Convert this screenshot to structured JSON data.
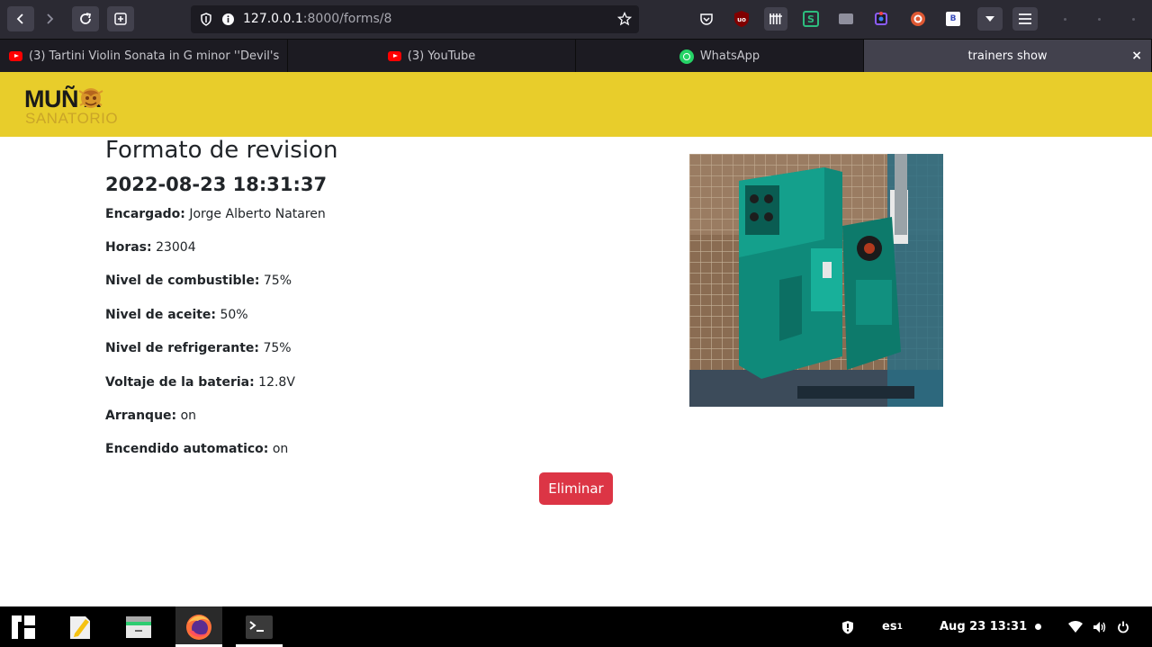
{
  "browser": {
    "url_host": "127.0.0.1",
    "url_path": ":8000/forms/8",
    "tabs": [
      {
        "label": "(3) Tartini Violin Sonata in G minor ''Devil's",
        "icon": "youtube-icon"
      },
      {
        "label": "(3) YouTube",
        "icon": "youtube-icon"
      },
      {
        "label": "WhatsApp",
        "icon": "whatsapp-icon"
      },
      {
        "label": "trainers show",
        "icon": ""
      }
    ],
    "close_tab_glyph": "×",
    "extensions": [
      {
        "name": "pocket-icon"
      },
      {
        "name": "ublock-icon",
        "text": "uo"
      },
      {
        "name": "columns-extension-icon"
      },
      {
        "name": "s-extension-icon",
        "text": "S"
      },
      {
        "name": "keyboard-extension-icon"
      },
      {
        "name": "puzzle-extension-icon"
      },
      {
        "name": "duckduckgo-icon"
      },
      {
        "name": "b-extension-icon",
        "text": "B"
      }
    ]
  },
  "site": {
    "logo_text": "MUÑ A",
    "logo_subtext": "SANATORIO",
    "brand_color": "#e8cd2b"
  },
  "form": {
    "title": "Formato de revision",
    "datetime": "2022-08-23 18:31:37",
    "fields": [
      {
        "label": "Encargado:",
        "value": "Jorge Alberto Nataren"
      },
      {
        "label": "Horas:",
        "value": "23004"
      },
      {
        "label": "Nivel de combustible:",
        "value": "75%"
      },
      {
        "label": "Nivel de aceite:",
        "value": "50%"
      },
      {
        "label": "Nivel de refrigerante:",
        "value": "75%"
      },
      {
        "label": "Voltaje de la bateria:",
        "value": "12.8V"
      },
      {
        "label": "Arranque:",
        "value": "on"
      },
      {
        "label": "Encendido automatico:",
        "value": "on"
      }
    ],
    "delete_label": "Eliminar",
    "delete_color": "#dc3545"
  },
  "taskbar": {
    "keyboard_layout": "es",
    "keyboard_layout_index": "1",
    "datetime": "Aug 23  13:31"
  }
}
